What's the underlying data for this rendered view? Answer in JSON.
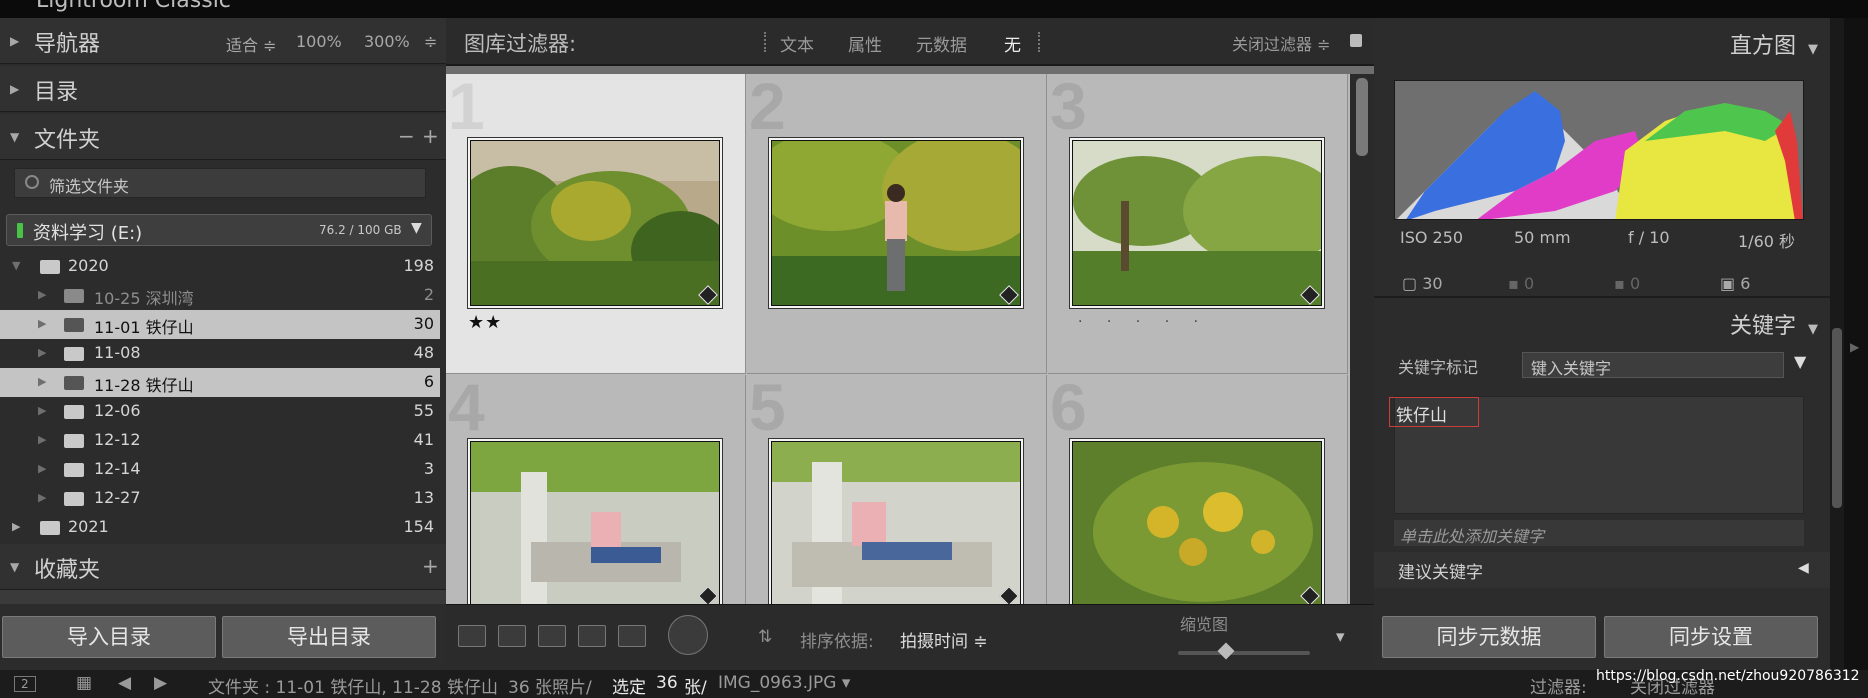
{
  "app": {
    "title": "Lightroom Classic"
  },
  "left": {
    "navigator": {
      "title": "导航器",
      "options": [
        "适合 ≑",
        "100%",
        "300%",
        "≑"
      ]
    },
    "catalog": {
      "title": "目录"
    },
    "folders": {
      "title": "文件夹",
      "minus": "−",
      "plus": "+",
      "filter_placeholder": "筛选文件夹",
      "volume": {
        "name": "资料学习 (E:)",
        "size": "76.2 / 100 GB"
      },
      "items": [
        {
          "name": "2020",
          "count": "198"
        },
        {
          "name": "10-25 深圳湾",
          "count": "2"
        },
        {
          "name": "11-01 铁仔山",
          "count": "30"
        },
        {
          "name": "11-08",
          "count": "48"
        },
        {
          "name": "11-28 铁仔山",
          "count": "6"
        },
        {
          "name": "12-06",
          "count": "55"
        },
        {
          "name": "12-12",
          "count": "41"
        },
        {
          "name": "12-14",
          "count": "3"
        },
        {
          "name": "12-27",
          "count": "13"
        },
        {
          "name": "2021",
          "count": "154"
        }
      ]
    },
    "collections": {
      "title": "收藏夹",
      "plus": "+"
    },
    "import_btn": "导入目录",
    "export_btn": "导出目录"
  },
  "center": {
    "filter": {
      "title": "图库过滤器:",
      "options": [
        "文本",
        "属性",
        "元数据",
        "无"
      ],
      "close": "关闭过滤器 ≑"
    },
    "cells": [
      {
        "num": "1",
        "stars": "★★",
        "dots": ""
      },
      {
        "num": "2",
        "stars": "",
        "dots": ""
      },
      {
        "num": "3",
        "stars": "",
        "dots": "· · · · ·"
      },
      {
        "num": "4",
        "stars": "",
        "dots": ""
      },
      {
        "num": "5",
        "stars": "",
        "dots": ""
      },
      {
        "num": "6",
        "stars": "",
        "dots": ""
      }
    ],
    "toolbar": {
      "sort_label": "排序依据:",
      "sort_value": "拍摄时间 ≑",
      "thumb_label": "缩览图"
    }
  },
  "right": {
    "histogram": {
      "title": "直方图",
      "iso": "ISO 250",
      "focal": "50 mm",
      "aperture": "f / 10",
      "shutter": "1/60 秒",
      "counts": [
        "30",
        "0",
        "0",
        "6"
      ]
    },
    "keywords": {
      "title": "关键字",
      "tag_label": "关键字标记",
      "tag_select": "键入关键字",
      "tag": "铁仔山",
      "add_hint": "单击此处添加关键字",
      "suggest": "建议关键字"
    },
    "sync_meta": "同步元数据",
    "sync_settings": "同步设置"
  },
  "status": {
    "page": "2",
    "path": "文件夹 : 11-01 铁仔山, 11-28 铁仔山",
    "count": "36 张照片/ ",
    "sel_prefix": "选定",
    "sel_count": "36",
    "sel_suffix": "张/",
    "file": "IMG_0963.JPG ▾",
    "filter": "过滤器:",
    "filter_val": "关闭过滤器",
    "watermark": "https://blog.csdn.net/zhou920786312"
  }
}
